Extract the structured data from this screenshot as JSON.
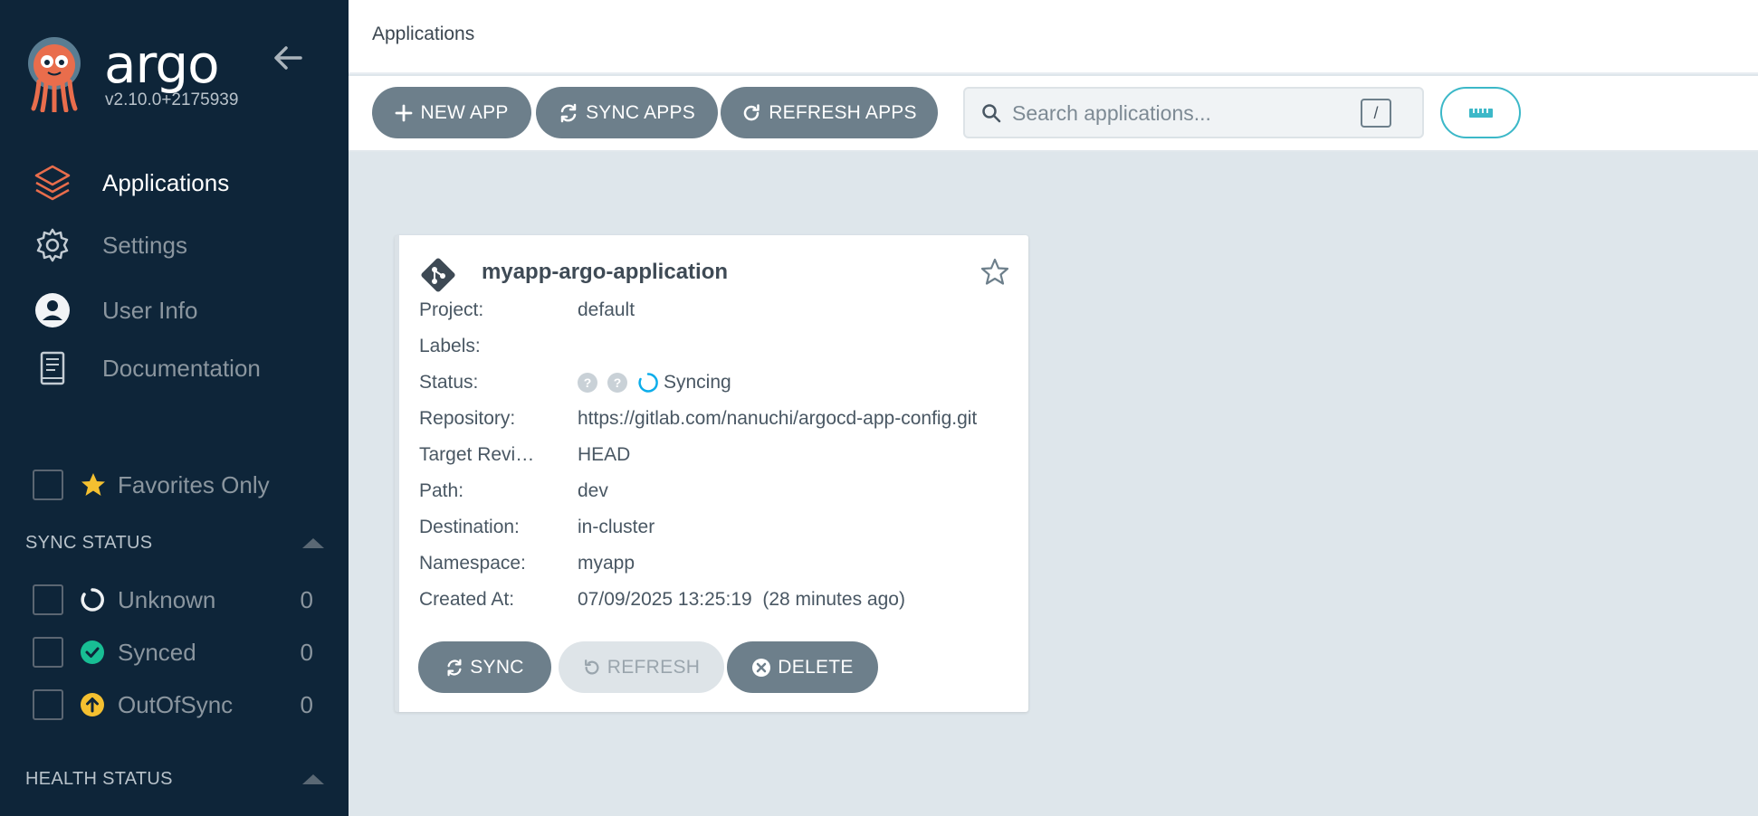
{
  "sidebar": {
    "brand": "argo",
    "version": "v2.10.0+2175939",
    "nav": [
      {
        "label": "Applications",
        "icon": "layers-icon",
        "active": true
      },
      {
        "label": "Settings",
        "icon": "gear-icon",
        "active": false
      },
      {
        "label": "User Info",
        "icon": "user-circle-icon",
        "active": false
      },
      {
        "label": "Documentation",
        "icon": "book-icon",
        "active": false
      }
    ],
    "favorites_label": "Favorites Only",
    "sync_status": {
      "title": "SYNC STATUS",
      "items": [
        {
          "label": "Unknown",
          "count": "0",
          "icon": "circle-notch-icon"
        },
        {
          "label": "Synced",
          "count": "0",
          "icon": "check-circle-icon"
        },
        {
          "label": "OutOfSync",
          "count": "0",
          "icon": "arrow-up-circle-icon"
        }
      ]
    },
    "health_status": {
      "title": "HEALTH STATUS"
    }
  },
  "header": {
    "title": "Applications"
  },
  "toolbar": {
    "new_app": "NEW APP",
    "sync_apps": "SYNC APPS",
    "refresh_apps": "REFRESH APPS",
    "search_placeholder": "Search applications...",
    "search_shortcut": "/"
  },
  "app_card": {
    "name": "myapp-argo-application",
    "fields": [
      {
        "key": "Project:",
        "value": "default"
      },
      {
        "key": "Labels:",
        "value": ""
      },
      {
        "key": "Status:",
        "value": "Syncing"
      },
      {
        "key": "Repository:",
        "value": "https://gitlab.com/nanuchi/argocd-app-config.git"
      },
      {
        "key": "Target Revi…",
        "value": "HEAD"
      },
      {
        "key": "Path:",
        "value": "dev"
      },
      {
        "key": "Destination:",
        "value": "in-cluster"
      },
      {
        "key": "Namespace:",
        "value": "myapp"
      },
      {
        "key": "Created At:",
        "value": "07/09/2025 13:25:19  (28 minutes ago)"
      }
    ],
    "actions": {
      "sync": "SYNC",
      "refresh": "REFRESH",
      "delete": "DELETE"
    }
  },
  "colors": {
    "sidebar_bg": "#0e2539",
    "accent_orange": "#e96d4c",
    "button_gray": "#6d7f8b",
    "synced_green": "#18be94",
    "outofsync_yellow": "#f4c030",
    "syncing_blue": "#0dadea",
    "teal_outline": "#3cb8c8"
  }
}
